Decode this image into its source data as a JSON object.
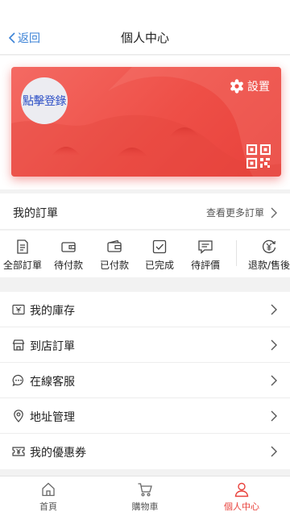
{
  "header": {
    "back_label": "返回",
    "title": "個人中心"
  },
  "card": {
    "login_label": "點擊登錄",
    "settings_label": "設置",
    "accent": "#ee4f47"
  },
  "orders": {
    "title": "我的訂單",
    "more_label": "查看更多訂單",
    "items": [
      {
        "label": "全部訂單",
        "icon": "order-list-icon"
      },
      {
        "label": "待付款",
        "icon": "wallet-icon"
      },
      {
        "label": "已付款",
        "icon": "paid-wallet-icon"
      },
      {
        "label": "已完成",
        "icon": "check-box-icon"
      },
      {
        "label": "待評價",
        "icon": "comment-icon"
      },
      {
        "label": "退款/售後",
        "icon": "refund-icon"
      }
    ]
  },
  "menu": [
    {
      "label": "我的庫存",
      "icon": "inventory-icon"
    },
    {
      "label": "到店訂單",
      "icon": "store-icon"
    },
    {
      "label": "在線客服",
      "icon": "chat-icon"
    },
    {
      "label": "地址管理",
      "icon": "location-icon"
    },
    {
      "label": "我的優惠券",
      "icon": "coupon-icon"
    }
  ],
  "tabbar": [
    {
      "label": "首頁",
      "icon": "home-icon"
    },
    {
      "label": "購物車",
      "icon": "cart-icon"
    },
    {
      "label": "個人中心",
      "icon": "user-icon",
      "active": true
    }
  ],
  "active_tab_color": "#e8413b"
}
